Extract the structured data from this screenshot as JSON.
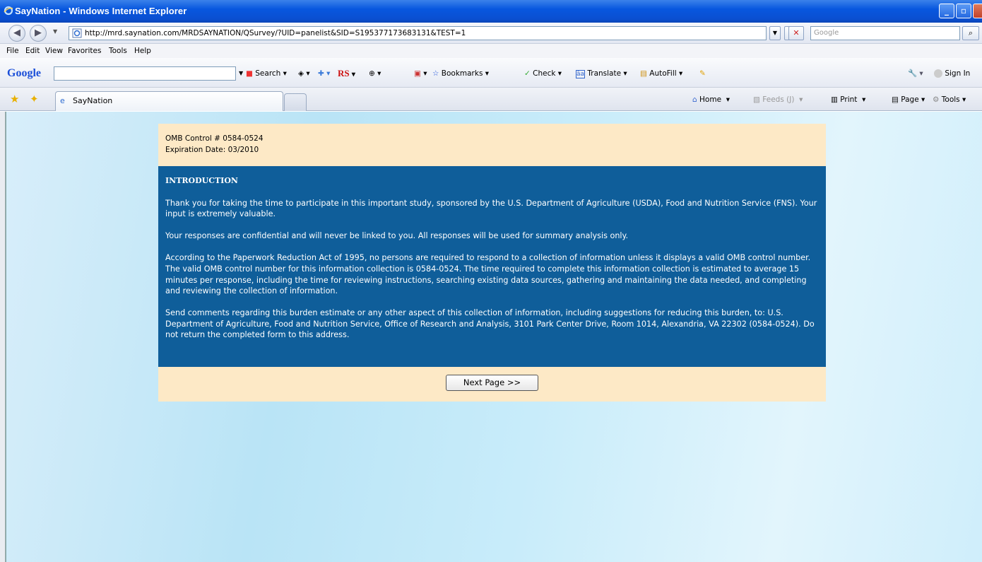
{
  "window": {
    "title": "SayNation - Windows Internet Explorer"
  },
  "address": {
    "url": "http://mrd.saynation.com/MRDSAYNATION/QSurvey/?UID=panelist&SID=S195377173683131&TEST=1",
    "search_placeholder": "Google"
  },
  "menu": [
    "File",
    "Edit",
    "View",
    "Favorites",
    "Tools",
    "Help"
  ],
  "google_toolbar": {
    "logo": "Google",
    "search": "Search",
    "rs": "RS",
    "bookmarks": "Bookmarks",
    "check": "Check",
    "translate": "Translate",
    "autofill": "AutoFill",
    "sign_in": "Sign In"
  },
  "tabs": {
    "active": "SayNation"
  },
  "command_bar": {
    "home": "Home",
    "feeds": "Feeds (J)",
    "print": "Print",
    "page": "Page",
    "tools": "Tools"
  },
  "survey": {
    "omb_control": "OMB Control # 0584-0524",
    "expiration": "Expiration Date: 03/2010",
    "heading": "INTRODUCTION",
    "paragraphs": [
      "Thank you for taking the time to participate in this important study, sponsored by the U.S. Department of Agriculture (USDA), Food and Nutrition Service (FNS). Your input is extremely valuable.",
      "Your responses are confidential and will never be linked to you. All responses will be used for summary analysis only.",
      "According to the Paperwork Reduction Act of 1995, no persons are required to respond to a collection of information unless it displays a valid OMB control number. The valid OMB control number for this information collection is 0584-0524. The time required to complete this information collection is estimated to average 15 minutes per response, including the time for reviewing instructions, searching existing data sources, gathering and maintaining the data needed, and completing and reviewing the collection of information.",
      "Send comments regarding this burden estimate or any other aspect of this collection of information, including suggestions for reducing this burden, to: U.S. Department of Agriculture, Food and Nutrition Service, Office of Research and Analysis, 3101 Park Center Drive, Room 1014, Alexandria, VA 22302 (0584-0524). Do not return the completed form to this address."
    ],
    "next_button": "Next Page >>"
  },
  "colors": {
    "panel_bg": "#fde9c6",
    "intro_bg": "#0f5e9a",
    "titlebar": "#0857df"
  }
}
